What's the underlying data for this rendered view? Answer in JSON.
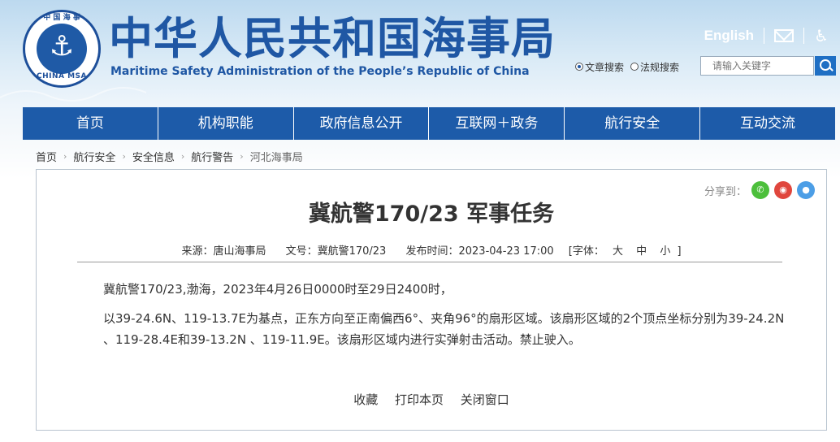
{
  "header": {
    "logo_text_top": "中 国 海 事",
    "logo_text_bottom": "CHINA MSA",
    "site_title_cn": "中华人民共和国海事局",
    "site_title_en": "Maritime Safety Administration of the People’s Republic of China",
    "english_link": "English",
    "mail_icon": "mail-icon",
    "accessibility_icon": "accessibility-icon"
  },
  "search": {
    "option_article": "文章搜索",
    "option_law": "法规搜索",
    "selected": "文章搜索",
    "placeholder": "请输入关键字",
    "button_icon": "search-icon"
  },
  "nav": {
    "items": [
      "首页",
      "机构职能",
      "政府信息公开",
      "互联网＋政务",
      "航行安全",
      "互动交流"
    ]
  },
  "breadcrumb": {
    "items": [
      "首页",
      "航行安全",
      "安全信息",
      "航行警告",
      "河北海事局"
    ]
  },
  "article": {
    "share_label": "分享到：",
    "share_icons": [
      "wechat-icon",
      "weibo-icon",
      "qq-icon"
    ],
    "title": "冀航警170/23 军事任务",
    "source": "来源：唐山海事局",
    "doc_no": "文号：冀航警170/23",
    "publish_time": "发布时间：2023-04-23 17:00",
    "font_size_label": "[字体：",
    "font_large": "大",
    "font_medium": "中",
    "font_small": "小",
    "font_close": "]",
    "paragraph1": "冀航警170/23,渤海，2023年4月26日0000时至29日2400时，",
    "paragraph2": "以39-24.6N、119-13.7E为基点，正东方向至正南偏西6°、夹角96°的扇形区域。该扇形区域的2个顶点坐标分别为39-24.2N 、119-28.4E和39-13.2N 、119-11.9E。该扇形区域内进行实弹射击活动。禁止驶入。",
    "action_favorite": "收藏",
    "action_print": "打印本页",
    "action_close": "关闭窗口"
  }
}
